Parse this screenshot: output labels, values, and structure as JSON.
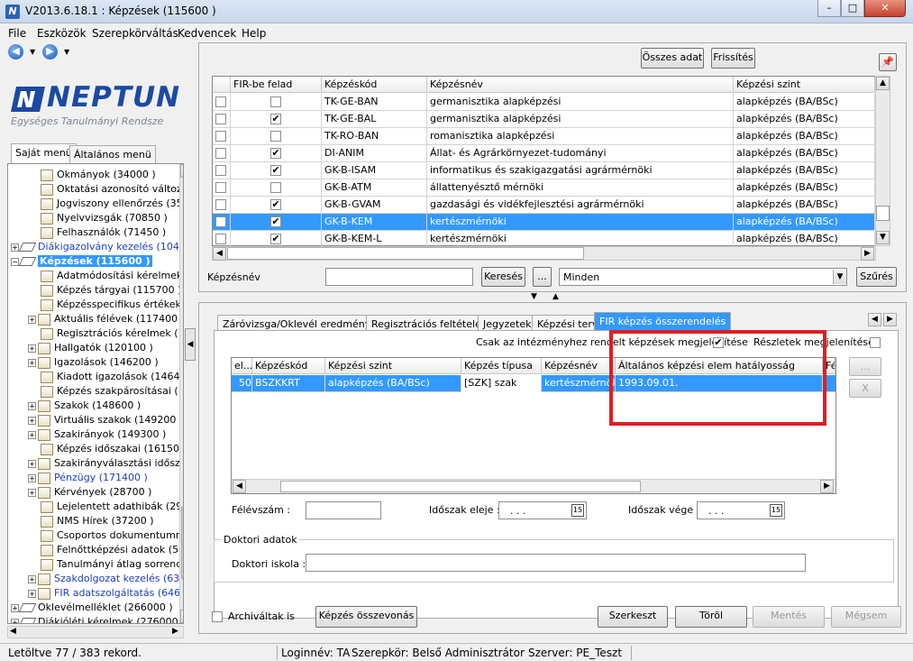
{
  "window": {
    "title": "V2013.6.18.1 : Képzések (115600  )",
    "app_icon": "neptun-app-icon",
    "minimize": "–",
    "maximize": "□",
    "close": "✕"
  },
  "menubar": [
    "File",
    "Eszközök",
    "Szerepkörváltás",
    "Kedvencek",
    "Help"
  ],
  "logo": {
    "name": "NEPTUN",
    "subtitle": "Egységes Tanulmányi Rendsze"
  },
  "left_tabs": [
    "Saját menü",
    "Általános menü"
  ],
  "tree": [
    {
      "label": "Okmányok (34000  )",
      "indent": 2,
      "type": "doc",
      "plus": false,
      "blue": false
    },
    {
      "label": "Oktatási azonosító változa",
      "indent": 2,
      "type": "doc",
      "plus": false,
      "blue": false
    },
    {
      "label": "Jogviszony ellenőrzés (350",
      "indent": 2,
      "type": "doc",
      "plus": false,
      "blue": false
    },
    {
      "label": "Nyelvvizsgák (70850  )",
      "indent": 2,
      "type": "doc",
      "plus": false,
      "blue": false
    },
    {
      "label": "Felhasználók (71450  )",
      "indent": 2,
      "type": "doc",
      "plus": false,
      "blue": false
    },
    {
      "label": "Diákigazolvány kezelés (1040",
      "indent": 0,
      "type": "dia",
      "plus": "+",
      "blue": true
    },
    {
      "label": "Képzések (115600  )",
      "indent": 0,
      "type": "dia",
      "plus": "−",
      "blue": true,
      "selected": true
    },
    {
      "label": "Adatmódosítási kérelmek",
      "indent": 2,
      "type": "doc",
      "plus": false,
      "blue": false
    },
    {
      "label": "Képzés tárgyai (115700  )",
      "indent": 2,
      "type": "doc",
      "plus": false,
      "blue": false
    },
    {
      "label": "Képzésspecifikus értékek",
      "indent": 2,
      "type": "doc",
      "plus": false,
      "blue": false
    },
    {
      "label": "Aktuális félévek (117400",
      "indent": 1,
      "type": "doc",
      "plus": "+",
      "blue": false
    },
    {
      "label": "Regisztrációs kérelmek (1",
      "indent": 2,
      "type": "doc",
      "plus": false,
      "blue": false
    },
    {
      "label": "Hallgatók (120100  )",
      "indent": 1,
      "type": "doc",
      "plus": "+",
      "blue": false
    },
    {
      "label": "Igazolások (146200  )",
      "indent": 1,
      "type": "doc",
      "plus": "+",
      "blue": false
    },
    {
      "label": "Kiadott igazolások (14640",
      "indent": 2,
      "type": "doc",
      "plus": false,
      "blue": false
    },
    {
      "label": "Képzés szakpárosításai (1",
      "indent": 2,
      "type": "doc",
      "plus": false,
      "blue": false
    },
    {
      "label": "Szakok (148600  )",
      "indent": 1,
      "type": "doc",
      "plus": "+",
      "blue": false
    },
    {
      "label": "Virtuális szakok (149200  )",
      "indent": 1,
      "type": "doc",
      "plus": "+",
      "blue": false
    },
    {
      "label": "Szakirányok (149300  )",
      "indent": 1,
      "type": "doc",
      "plus": "+",
      "blue": false
    },
    {
      "label": "Képzés időszakai (161500",
      "indent": 2,
      "type": "doc",
      "plus": false,
      "blue": false
    },
    {
      "label": "Szakirányválasztási időszak",
      "indent": 1,
      "type": "doc",
      "plus": "+",
      "blue": false
    },
    {
      "label": "Pénzügy (171400  )",
      "indent": 1,
      "type": "doc",
      "plus": "+",
      "blue": true
    },
    {
      "label": "Kérvények (28700  )",
      "indent": 1,
      "type": "doc",
      "plus": "+",
      "blue": false
    },
    {
      "label": "Lejelentett adathibák (291",
      "indent": 2,
      "type": "doc",
      "plus": false,
      "blue": false
    },
    {
      "label": "NMS Hírek (37200  )",
      "indent": 2,
      "type": "doc",
      "plus": false,
      "blue": false
    },
    {
      "label": "Csoportos dokumentumme",
      "indent": 2,
      "type": "doc",
      "plus": false,
      "blue": false
    },
    {
      "label": "Felnőttképzési adatok (57",
      "indent": 2,
      "type": "doc",
      "plus": false,
      "blue": false
    },
    {
      "label": "Tanulmányi átlag sorrend",
      "indent": 2,
      "type": "doc",
      "plus": false,
      "blue": false
    },
    {
      "label": "Szakdolgozat kezelés (63",
      "indent": 1,
      "type": "doc",
      "plus": "+",
      "blue": true
    },
    {
      "label": "FIR adatszolgáltatás (646",
      "indent": 1,
      "type": "doc",
      "plus": "+",
      "blue": true
    },
    {
      "label": "Oklevélmelléklet (266000  )",
      "indent": 0,
      "type": "dia",
      "plus": "+",
      "blue": false
    },
    {
      "label": "Diákjóléti kérelmek (276000  )",
      "indent": 0,
      "type": "dia",
      "plus": "+",
      "blue": false
    }
  ],
  "top_buttons": {
    "all_data": "Összes adat",
    "refresh": "Frissítés"
  },
  "grid1": {
    "columns": [
      "FIR-be felad",
      "Képzéskód",
      "Képzésnév",
      "Képzési szint"
    ],
    "rows": [
      {
        "checked": false,
        "fir": false,
        "code": "TK-GE-BAN",
        "name": "germanisztika alapképzési",
        "level": "alapképzés (BA/BSc)"
      },
      {
        "checked": false,
        "fir": true,
        "code": "TK-GE-BAL",
        "name": "germanisztika alapképzési",
        "level": "alapképzés (BA/BSc)"
      },
      {
        "checked": false,
        "fir": false,
        "code": "TK-RO-BAN",
        "name": "romanisztika alapképzési",
        "level": "alapképzés (BA/BSc)"
      },
      {
        "checked": false,
        "fir": true,
        "code": "DI-ANIM",
        "name": "Állat- és Agrárkörnyezet-tudományi",
        "level": "alapképzés (BA/BSc)"
      },
      {
        "checked": false,
        "fir": true,
        "code": "GK-B-ISAM",
        "name": "informatikus és szakigazgatási agrármérnöki",
        "level": "alapképzés (BA/BSc)"
      },
      {
        "checked": false,
        "fir": false,
        "code": "GK-B-ATM",
        "name": "állattenyésztő mérnöki",
        "level": "alapképzés (BA/BSc)"
      },
      {
        "checked": false,
        "fir": true,
        "code": "GK-B-GVAM",
        "name": "gazdasági és vidékfejlesztési agrármérnöki",
        "level": "alapképzés (BA/BSc)"
      },
      {
        "checked": false,
        "fir": true,
        "code": "GK-B-KEM",
        "name": "kertészmérnöki",
        "level": "alapképzés (BA/BSc)",
        "selected": true
      },
      {
        "checked": false,
        "fir": true,
        "code": "GK-B-KEM-L",
        "name": "kertészmérnöki",
        "level": "alapképzés (BA/BSc)"
      }
    ]
  },
  "search": {
    "label": "Képzésnév",
    "value": "",
    "search_button": "Keresés",
    "ellipsis": "...",
    "filter_value": "Minden",
    "filter_button": "Szűrés"
  },
  "bottom_tabs": [
    "Záróvizsga/Oklevél eredmények",
    "Regisztrációs feltételek",
    "Jegyzetek",
    "Képzési terv",
    "FIR képzés összerendelés"
  ],
  "fir_tab": {
    "only_institution_label": "Csak az intézményhez rendelt képzések megjelenítése",
    "only_institution_checked": true,
    "details_label": "Részletek megjelenítése",
    "details_checked": false,
    "grid_columns": [
      "el...",
      "Képzéskód",
      "Képzési szint",
      "Képzés típusa",
      "Képzésnév",
      "Általános képzési elem hatályosság kezdete",
      "Fé"
    ],
    "grid_rows": [
      {
        "el": "50",
        "code": "BSZKKRT",
        "level": "alapképzés (BA/BSc)",
        "type": "[SZK] szak",
        "name": "kertészmérnök",
        "start": "1993.09.01."
      }
    ],
    "side_buttons": {
      "more": "...",
      "remove": "X"
    },
    "semester_label": "Félévszám :",
    "semester_value": "",
    "period_start_label": "Időszak eleje :",
    "period_start_value": ". . .",
    "period_end_label": "Időszak vége :",
    "period_end_value": ". . .",
    "calendar_glyph": "15",
    "doctoral_group": "Doktori adatok",
    "doctoral_school_label": "Doktori iskola :",
    "doctoral_school_value": ""
  },
  "bottom_actions": {
    "archived_label": "Archiváltak is",
    "archived_checked": false,
    "merge": "Képzés összevonás",
    "edit": "Szerkeszt",
    "delete": "Töröl",
    "save": "Mentés",
    "cancel": "Mégsem"
  },
  "statusbar": {
    "records": "Letöltve 77 / 383 rekord.",
    "login": "Loginnév: TA",
    "role": "Szerepkör: Belső Adminisztrátor",
    "server": "Szerver: PE_Teszt"
  },
  "colors": {
    "selection": "#3399ff",
    "highlight_box": "#e01d22",
    "logo_blue": "#1b4aa3",
    "tree_blue": "#1b3fc4"
  }
}
